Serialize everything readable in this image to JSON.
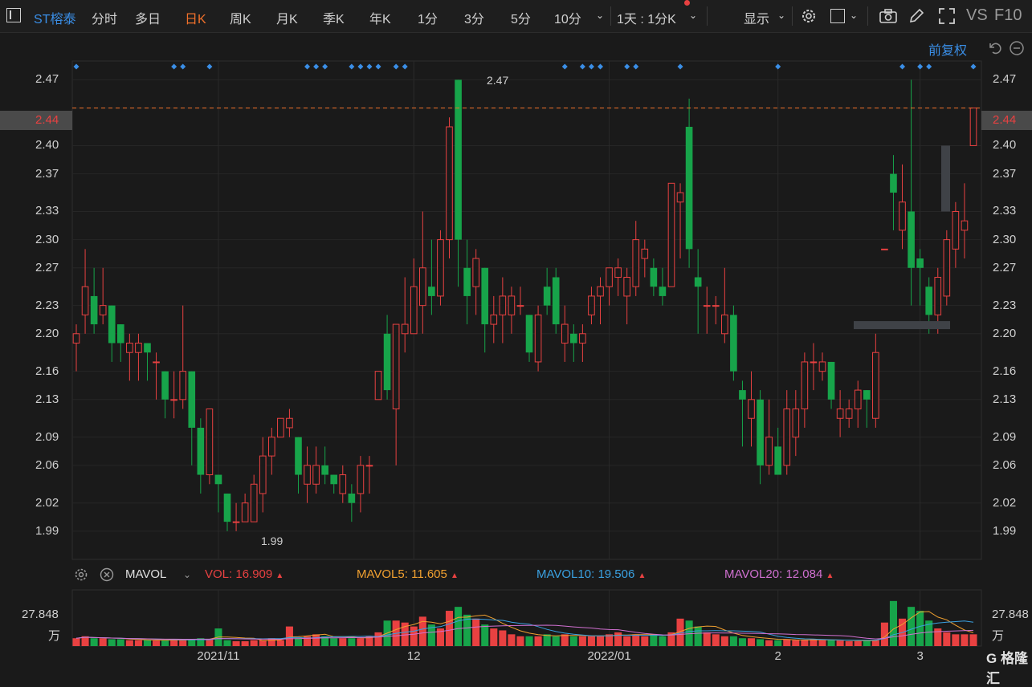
{
  "toolbar": {
    "stock_name": "ST榕泰",
    "periods": [
      "分时",
      "多日",
      "日K",
      "周K",
      "月K",
      "季K",
      "年K",
      "1分",
      "3分",
      "5分",
      "10分"
    ],
    "active_period": "日K",
    "interval_label": "1天 : 1分K",
    "display_label": "显示",
    "vs_label": "VS",
    "f10_label": "F10"
  },
  "adjust_label": "前复权",
  "colors": {
    "up": "#e84141",
    "down": "#17a44a",
    "accent": "#f0702a",
    "blue": "#3a8ee6",
    "ma5": "#f0a030",
    "ma10": "#3aa0e0",
    "ma20": "#d070d0"
  },
  "price_axis": {
    "ticks": [
      "2.47",
      "2.44",
      "2.40",
      "2.37",
      "2.33",
      "2.30",
      "2.27",
      "2.23",
      "2.20",
      "2.16",
      "2.13",
      "2.09",
      "2.06",
      "2.02",
      "1.99"
    ],
    "current": "2.44",
    "high_label": "2.47",
    "low_label": "1.99"
  },
  "volume_legend": {
    "name": "MAVOL",
    "vol_label": "VOL:",
    "vol_value": "16.909",
    "ma5_label": "MAVOL5:",
    "ma5_value": "11.605",
    "ma10_label": "MAVOL10:",
    "ma10_value": "19.506",
    "ma20_label": "MAVOL20:",
    "ma20_value": "12.084"
  },
  "volume_axis": {
    "max_label": "27.848",
    "unit_label": "万"
  },
  "x_axis": {
    "labels": [
      "2021/11",
      "12",
      "2022/01",
      "2",
      "3"
    ]
  },
  "watermark": "G 格隆汇",
  "chart_data": {
    "type": "candlestick",
    "ylim": [
      1.96,
      2.49
    ],
    "x_labels": [
      "2021/11",
      "12",
      "2022/01",
      "2",
      "3"
    ],
    "x_label_index": [
      16,
      38,
      60,
      79,
      95
    ],
    "candles": [
      {
        "o": 2.19,
        "c": 2.2,
        "h": 2.21,
        "l": 2.16
      },
      {
        "o": 2.22,
        "c": 2.25,
        "h": 2.29,
        "l": 2.2
      },
      {
        "o": 2.24,
        "c": 2.21,
        "h": 2.27,
        "l": 2.2
      },
      {
        "o": 2.22,
        "c": 2.23,
        "h": 2.27,
        "l": 2.21
      },
      {
        "o": 2.23,
        "c": 2.19,
        "h": 2.23,
        "l": 2.17
      },
      {
        "o": 2.21,
        "c": 2.19,
        "h": 2.21,
        "l": 2.17
      },
      {
        "o": 2.18,
        "c": 2.19,
        "h": 2.2,
        "l": 2.15
      },
      {
        "o": 2.18,
        "c": 2.19,
        "h": 2.2,
        "l": 2.15
      },
      {
        "o": 2.19,
        "c": 2.18,
        "h": 2.19,
        "l": 2.15
      },
      {
        "o": 2.17,
        "c": 2.17,
        "h": 2.18,
        "l": 2.13
      },
      {
        "o": 2.16,
        "c": 2.13,
        "h": 2.16,
        "l": 2.11
      },
      {
        "o": 2.13,
        "c": 2.13,
        "h": 2.16,
        "l": 2.11
      },
      {
        "o": 2.13,
        "c": 2.16,
        "h": 2.23,
        "l": 2.12
      },
      {
        "o": 2.16,
        "c": 2.1,
        "h": 2.16,
        "l": 2.06
      },
      {
        "o": 2.1,
        "c": 2.05,
        "h": 2.11,
        "l": 2.03
      },
      {
        "o": 2.05,
        "c": 2.12,
        "h": 2.12,
        "l": 2.04
      },
      {
        "o": 2.05,
        "c": 2.04,
        "h": 2.05,
        "l": 2.01
      },
      {
        "o": 2.03,
        "c": 2.0,
        "h": 2.03,
        "l": 1.99
      },
      {
        "o": 2.0,
        "c": 2.0,
        "h": 2.02,
        "l": 1.99
      },
      {
        "o": 2.0,
        "c": 2.02,
        "h": 2.03,
        "l": 2.0
      },
      {
        "o": 2.0,
        "c": 2.04,
        "h": 2.05,
        "l": 2.0
      },
      {
        "o": 2.03,
        "c": 2.07,
        "h": 2.09,
        "l": 2.01
      },
      {
        "o": 2.07,
        "c": 2.09,
        "h": 2.1,
        "l": 2.05
      },
      {
        "o": 2.09,
        "c": 2.11,
        "h": 2.11,
        "l": 2.09
      },
      {
        "o": 2.1,
        "c": 2.11,
        "h": 2.12,
        "l": 2.09
      },
      {
        "o": 2.09,
        "c": 2.05,
        "h": 2.09,
        "l": 2.03
      },
      {
        "o": 2.04,
        "c": 2.06,
        "h": 2.08,
        "l": 2.02
      },
      {
        "o": 2.04,
        "c": 2.06,
        "h": 2.08,
        "l": 2.03
      },
      {
        "o": 2.06,
        "c": 2.05,
        "h": 2.08,
        "l": 2.04
      },
      {
        "o": 2.05,
        "c": 2.04,
        "h": 2.05,
        "l": 2.03
      },
      {
        "o": 2.03,
        "c": 2.05,
        "h": 2.06,
        "l": 2.02
      },
      {
        "o": 2.03,
        "c": 2.02,
        "h": 2.04,
        "l": 2.0
      },
      {
        "o": 2.03,
        "c": 2.06,
        "h": 2.07,
        "l": 2.01
      },
      {
        "o": 2.06,
        "c": 2.06,
        "h": 2.07,
        "l": 2.03
      },
      {
        "o": 2.13,
        "c": 2.16,
        "h": 2.16,
        "l": 2.13
      },
      {
        "o": 2.2,
        "c": 2.14,
        "h": 2.22,
        "l": 2.13
      },
      {
        "o": 2.12,
        "c": 2.21,
        "h": 2.21,
        "l": 2.06
      },
      {
        "o": 2.2,
        "c": 2.21,
        "h": 2.26,
        "l": 2.18
      },
      {
        "o": 2.2,
        "c": 2.25,
        "h": 2.28,
        "l": 2.2
      },
      {
        "o": 2.23,
        "c": 2.27,
        "h": 2.33,
        "l": 2.2
      },
      {
        "o": 2.25,
        "c": 2.24,
        "h": 2.3,
        "l": 2.22
      },
      {
        "o": 2.24,
        "c": 2.3,
        "h": 2.31,
        "l": 2.23
      },
      {
        "o": 2.3,
        "c": 2.42,
        "h": 2.43,
        "l": 2.28
      },
      {
        "o": 2.47,
        "c": 2.3,
        "h": 2.47,
        "l": 2.25
      },
      {
        "o": 2.27,
        "c": 2.24,
        "h": 2.3,
        "l": 2.21
      },
      {
        "o": 2.25,
        "c": 2.28,
        "h": 2.29,
        "l": 2.22
      },
      {
        "o": 2.27,
        "c": 2.21,
        "h": 2.27,
        "l": 2.18
      },
      {
        "o": 2.21,
        "c": 2.22,
        "h": 2.24,
        "l": 2.19
      },
      {
        "o": 2.22,
        "c": 2.24,
        "h": 2.26,
        "l": 2.19
      },
      {
        "o": 2.22,
        "c": 2.24,
        "h": 2.25,
        "l": 2.2
      },
      {
        "o": 2.23,
        "c": 2.23,
        "h": 2.25,
        "l": 2.22
      },
      {
        "o": 2.22,
        "c": 2.18,
        "h": 2.22,
        "l": 2.17
      },
      {
        "o": 2.17,
        "c": 2.22,
        "h": 2.23,
        "l": 2.16
      },
      {
        "o": 2.25,
        "c": 2.23,
        "h": 2.27,
        "l": 2.22
      },
      {
        "o": 2.26,
        "c": 2.21,
        "h": 2.27,
        "l": 2.2
      },
      {
        "o": 2.19,
        "c": 2.21,
        "h": 2.23,
        "l": 2.17
      },
      {
        "o": 2.2,
        "c": 2.19,
        "h": 2.21,
        "l": 2.17
      },
      {
        "o": 2.19,
        "c": 2.2,
        "h": 2.21,
        "l": 2.17
      },
      {
        "o": 2.22,
        "c": 2.24,
        "h": 2.25,
        "l": 2.21
      },
      {
        "o": 2.24,
        "c": 2.25,
        "h": 2.26,
        "l": 2.21
      },
      {
        "o": 2.25,
        "c": 2.27,
        "h": 2.27,
        "l": 2.23
      },
      {
        "o": 2.26,
        "c": 2.27,
        "h": 2.28,
        "l": 2.24
      },
      {
        "o": 2.24,
        "c": 2.26,
        "h": 2.27,
        "l": 2.21
      },
      {
        "o": 2.25,
        "c": 2.3,
        "h": 2.32,
        "l": 2.24
      },
      {
        "o": 2.28,
        "c": 2.29,
        "h": 2.3,
        "l": 2.26
      },
      {
        "o": 2.27,
        "c": 2.25,
        "h": 2.28,
        "l": 2.24
      },
      {
        "o": 2.25,
        "c": 2.24,
        "h": 2.27,
        "l": 2.23
      },
      {
        "o": 2.25,
        "c": 2.36,
        "h": 2.36,
        "l": 2.25
      },
      {
        "o": 2.34,
        "c": 2.35,
        "h": 2.36,
        "l": 2.28
      },
      {
        "o": 2.42,
        "c": 2.29,
        "h": 2.45,
        "l": 2.27
      },
      {
        "o": 2.26,
        "c": 2.25,
        "h": 2.29,
        "l": 2.2
      },
      {
        "o": 2.23,
        "c": 2.23,
        "h": 2.25,
        "l": 2.2
      },
      {
        "o": 2.23,
        "c": 2.23,
        "h": 2.24,
        "l": 2.21
      },
      {
        "o": 2.2,
        "c": 2.22,
        "h": 2.27,
        "l": 2.19
      },
      {
        "o": 2.22,
        "c": 2.16,
        "h": 2.23,
        "l": 2.15
      },
      {
        "o": 2.14,
        "c": 2.13,
        "h": 2.15,
        "l": 2.08
      },
      {
        "o": 2.11,
        "c": 2.13,
        "h": 2.16,
        "l": 2.08
      },
      {
        "o": 2.13,
        "c": 2.06,
        "h": 2.14,
        "l": 2.04
      },
      {
        "o": 2.06,
        "c": 2.09,
        "h": 2.13,
        "l": 2.05
      },
      {
        "o": 2.08,
        "c": 2.05,
        "h": 2.1,
        "l": 2.05
      },
      {
        "o": 2.06,
        "c": 2.12,
        "h": 2.14,
        "l": 2.05
      },
      {
        "o": 2.09,
        "c": 2.12,
        "h": 2.14,
        "l": 2.07
      },
      {
        "o": 2.12,
        "c": 2.17,
        "h": 2.18,
        "l": 2.1
      },
      {
        "o": 2.17,
        "c": 2.17,
        "h": 2.19,
        "l": 2.14
      },
      {
        "o": 2.16,
        "c": 2.17,
        "h": 2.18,
        "l": 2.15
      },
      {
        "o": 2.17,
        "c": 2.13,
        "h": 2.17,
        "l": 2.12
      },
      {
        "o": 2.11,
        "c": 2.12,
        "h": 2.14,
        "l": 2.09
      },
      {
        "o": 2.11,
        "c": 2.12,
        "h": 2.13,
        "l": 2.1
      },
      {
        "o": 2.12,
        "c": 2.14,
        "h": 2.15,
        "l": 2.1
      },
      {
        "o": 2.14,
        "c": 2.13,
        "h": 2.14,
        "l": 2.1
      },
      {
        "o": 2.11,
        "c": 2.18,
        "h": 2.2,
        "l": 2.1
      },
      {
        "o": 2.29,
        "c": 2.29,
        "h": 2.29,
        "l": 2.29
      },
      {
        "o": 2.37,
        "c": 2.35,
        "h": 2.39,
        "l": 2.31
      },
      {
        "o": 2.31,
        "c": 2.34,
        "h": 2.38,
        "l": 2.29
      },
      {
        "o": 2.33,
        "c": 2.27,
        "h": 2.47,
        "l": 2.23
      },
      {
        "o": 2.28,
        "c": 2.27,
        "h": 2.29,
        "l": 2.23
      },
      {
        "o": 2.25,
        "c": 2.22,
        "h": 2.26,
        "l": 2.2
      },
      {
        "o": 2.22,
        "c": 2.26,
        "h": 2.27,
        "l": 2.2
      },
      {
        "o": 2.24,
        "c": 2.3,
        "h": 2.31,
        "l": 2.23
      },
      {
        "o": 2.29,
        "c": 2.33,
        "h": 2.34,
        "l": 2.27
      },
      {
        "o": 2.31,
        "c": 2.32,
        "h": 2.36,
        "l": 2.28
      },
      {
        "o": 2.4,
        "c": 2.44,
        "h": 2.44,
        "l": 2.4
      }
    ],
    "volume": {
      "ylim": [
        0,
        27.848
      ],
      "values": [
        4,
        5,
        4,
        4,
        3.5,
        3.5,
        3,
        3,
        3,
        2.8,
        3,
        3.5,
        3,
        3.5,
        4,
        3.5,
        9,
        3,
        2.5,
        2.5,
        3,
        3,
        4,
        3,
        10,
        4,
        5,
        6,
        5,
        4,
        4,
        4,
        4,
        5,
        7,
        13,
        13,
        12,
        10,
        15,
        11,
        9,
        18,
        20,
        16,
        14,
        11,
        9,
        8,
        6,
        5,
        5,
        5,
        6,
        5,
        6,
        5,
        5,
        5,
        5,
        6,
        7,
        5,
        6,
        5,
        6,
        5,
        7,
        14,
        13,
        10,
        7,
        6,
        5,
        5,
        4,
        4,
        3.5,
        3,
        3,
        3.5,
        3,
        3,
        3.5,
        3,
        3,
        2.8,
        2.5,
        2.5,
        3,
        3,
        12,
        23,
        14,
        20,
        18,
        13,
        9,
        7,
        6,
        6,
        6,
        8
      ]
    }
  }
}
